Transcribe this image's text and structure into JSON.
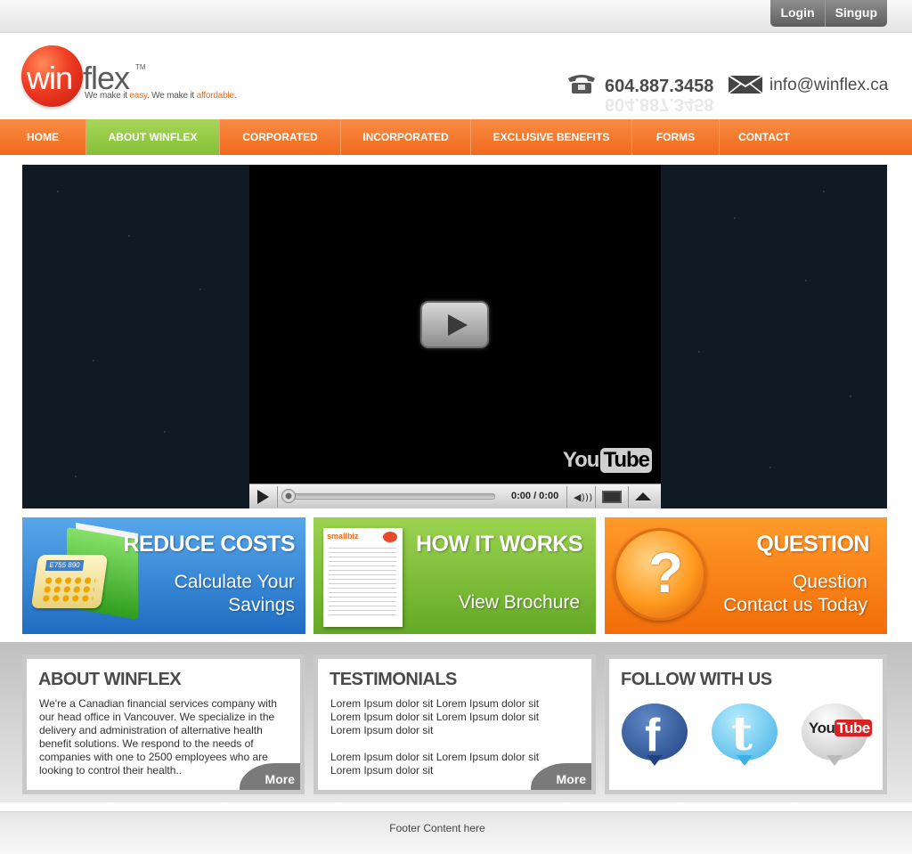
{
  "auth": {
    "login": "Login",
    "signup": "Singup"
  },
  "logo": {
    "win": "win",
    "flex": "flex",
    "tm": "TM",
    "tagline": {
      "part1": "We make it ",
      "easy": "easy",
      "part2": ". We make it ",
      "affordable": "affordable",
      "end": "."
    }
  },
  "contact": {
    "phone": "604.887.3458",
    "email": "info@winflex.ca",
    "phone_icon": "phone-icon",
    "mail_icon": "envelope-icon"
  },
  "nav": {
    "items": [
      {
        "label": "HOME",
        "active": false
      },
      {
        "label": "ABOUT WINFLEX",
        "active": true
      },
      {
        "label": "CORPORATED",
        "active": false
      },
      {
        "label": "INCORPORATED",
        "active": false
      },
      {
        "label": "EXCLUSIVE BENEFITS",
        "active": false
      },
      {
        "label": "FORMS",
        "active": false
      },
      {
        "label": "CONTACT",
        "active": false
      }
    ]
  },
  "video": {
    "brand": "You",
    "brand_box": "Tube",
    "time": "0:00 / 0:00",
    "progress": 0
  },
  "tiles": {
    "reduce": {
      "title": "REDUCE COSTS",
      "line1": "Calculate Your",
      "line2": "Savings",
      "calc_display": "E755 890"
    },
    "how": {
      "title": "HOW IT WORKS",
      "line1": "View Brochure",
      "brochure_head": "smallbiz"
    },
    "question": {
      "title": "QUESTION",
      "line1": "Question",
      "line2": "Contact us Today",
      "glyph": "?"
    }
  },
  "cards": {
    "about": {
      "title": "ABOUT WINFLEX",
      "text": "We're a Canadian financial services company with our head office in Vancouver. We specialize in the delivery and administration of alternative health benefit solutions. We respond to the needs of companies with one to 2500 employees who are looking to control their health..",
      "more": "More"
    },
    "testimonials": {
      "title": "TESTIMONIALS",
      "p1": "Lorem Ipsum dolor sit Lorem Ipsum dolor sit Lorem Ipsum dolor sit  Lorem Ipsum dolor sit Lorem Ipsum dolor sit",
      "p2": "Lorem Ipsum dolor sit Lorem Ipsum dolor sit Lorem Ipsum dolor sit",
      "more": "More"
    },
    "follow": {
      "title": "FOLLOW WITH US",
      "facebook": "f",
      "twitter": "t",
      "youtube_a": "You",
      "youtube_b": "Tube"
    }
  },
  "footer": {
    "text": "Footer Content here"
  },
  "colors": {
    "orange": "#ef6a1c",
    "green": "#86bf35",
    "blue": "#1f6dc2",
    "gray": "#7a7a7a"
  }
}
